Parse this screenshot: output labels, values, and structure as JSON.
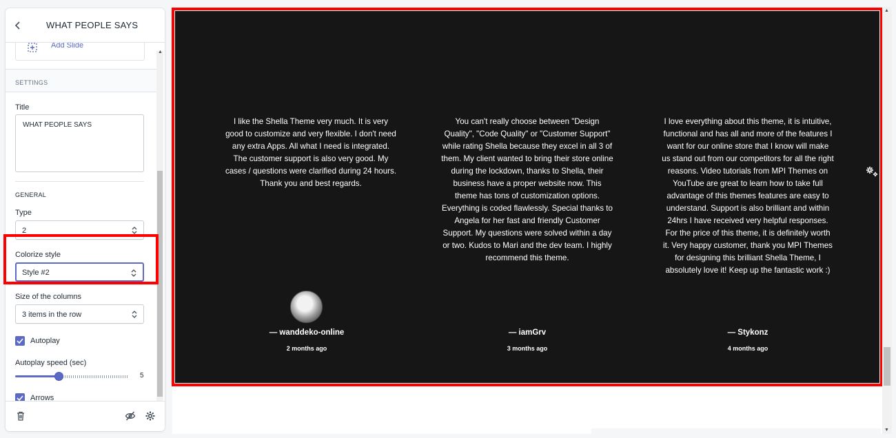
{
  "sidebar": {
    "title": "WHAT PEOPLE SAYS",
    "add_slide_label": "Add Slide",
    "settings_heading": "SETTINGS",
    "title_field_label": "Title",
    "title_field_value": "WHAT PEOPLE SAYS",
    "general_heading": "GENERAL",
    "type_label": "Type",
    "type_value": "2",
    "colorize_label": "Colorize style",
    "colorize_value": "Style #2",
    "columns_label": "Size of the columns",
    "columns_value": "3 items in the row",
    "autoplay_label": "Autoplay",
    "autoplay_checked": true,
    "autoplay_speed_label": "Autoplay speed (sec)",
    "autoplay_speed_value": "5",
    "arrows_label": "Arrows",
    "arrows_checked": true
  },
  "preview": {
    "background": "#161616",
    "testimonials": [
      {
        "text": "I like the Shella Theme very much. It is very good to customize and very flexible. I don't need any extra Apps. All what I need is integrated. The customer support is also very good. My cases / questions were clarified during 24 hours. Thank you and best regards.",
        "author": "— wanddeko-online",
        "date": "2 months ago",
        "has_avatar": true
      },
      {
        "text": "You can't really choose between \"Design Quality\", \"Code Quality\" or \"Customer Support\" while rating Shella because they excel in all 3 of them. My client wanted to bring their store online during the lockdown, thanks to Shella, their business have a proper website now. This theme has tons of customization options. Everything is coded flawlessly. Special thanks to Angela for her fast and friendly Customer Support. My questions were solved within a day or two. Kudos to Mari and the dev team. I highly recommend this theme.",
        "author": "— iamGrv",
        "date": "3 months ago",
        "has_avatar": false
      },
      {
        "text": "I love everything about this theme, it is intuitive, functional and has all and more of the features I want for our online store that I know will make us stand out from our competitors for all the right reasons. Video tutorials from MPI Themes on YouTube are great to learn how to take full advantage of this themes features are easy to understand. Support is also brilliant and within 24hrs I have received very helpful responses. For the price of this theme, it is definitely worth it. Very happy customer, thank you MPI Themes for designing this brilliant Shella Theme, I absolutely love it! Keep up the fantastic work :)",
        "author": "— Stykonz",
        "date": "4 months ago",
        "has_avatar": false
      }
    ]
  },
  "colors": {
    "accent": "#5c6ac4",
    "highlight": "#ff0000"
  }
}
